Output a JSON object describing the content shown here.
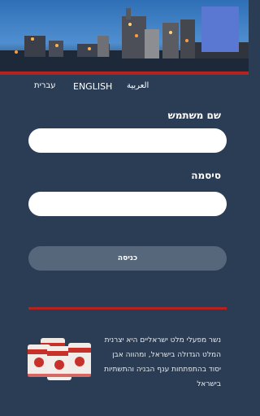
{
  "header": {
    "image": "cement-factory-night-photo",
    "logo": "brand-logo-placeholder"
  },
  "languages": {
    "hebrew": "עברית",
    "english": "ENGLISH",
    "arabic": "العربية"
  },
  "login": {
    "username_label": "שם משתמש",
    "username_value": "",
    "password_label": "סיסמה",
    "password_value": "",
    "submit_label": "כניסה"
  },
  "footer": {
    "about_text": "נשר מפעלי מלט ישראליים היא יצרנית המלט הגדולה בישראל, ומהווה אבן יסוד בהתפתחות ענף הבניה והתשתיות בישראל",
    "product_image": "cement-bags-icon"
  },
  "colors": {
    "background": "#2b3d55",
    "accent_red": "#b3231f",
    "button": "#56677c",
    "logo_block": "#5a78d2"
  }
}
